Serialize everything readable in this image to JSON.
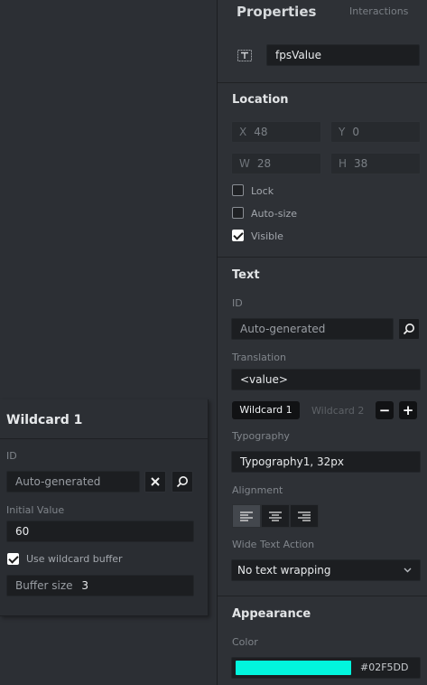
{
  "wildcard_panel": {
    "title": "Wildcard 1",
    "id_label": "ID",
    "id_placeholder": "Auto-generated",
    "initial_value_label": "Initial Value",
    "initial_value": "60",
    "use_buffer_label": "Use wildcard buffer",
    "use_buffer_checked": true,
    "buffer_size_label": "Buffer size",
    "buffer_size_value": "3"
  },
  "properties": {
    "tab_properties": "Properties",
    "tab_interactions": "Interactions",
    "widget_name": "fpsValue",
    "widget_icon": "text-widget-icon",
    "location": {
      "title": "Location",
      "x_key": "X",
      "x_value": "48",
      "y_key": "Y",
      "y_value": "0",
      "w_key": "W",
      "w_value": "28",
      "h_key": "H",
      "h_value": "38",
      "lock_label": "Lock",
      "lock_checked": false,
      "autosize_label": "Auto-size",
      "autosize_checked": false,
      "visible_label": "Visible",
      "visible_checked": true
    },
    "text": {
      "title": "Text",
      "id_label": "ID",
      "id_placeholder": "Auto-generated",
      "translation_label": "Translation",
      "translation_value": "<value>",
      "wildcard_tab_1": "Wildcard 1",
      "wildcard_tab_2": "Wildcard 2",
      "minus_symbol": "−",
      "plus_symbol": "+",
      "typography_label": "Typography",
      "typography_value": "Typography1, 32px",
      "alignment_label": "Alignment",
      "alignment_selected": "left",
      "wide_text_label": "Wide Text Action",
      "wide_text_value": "No text wrapping"
    },
    "appearance": {
      "title": "Appearance",
      "color_label": "Color",
      "color_hex": "#02F5DD",
      "color_swatch": "#02F5DD"
    }
  },
  "colors": {
    "background": "#2b2e33",
    "panel": "#2e3136",
    "field": "#1c1e21",
    "accent_text": "#e2e4e6"
  }
}
